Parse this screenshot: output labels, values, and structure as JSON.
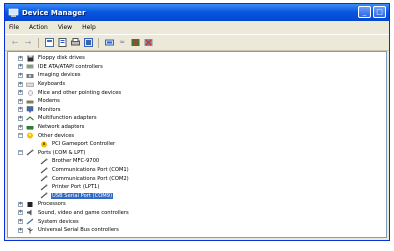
{
  "window": {
    "title": "Device Manager"
  },
  "menu": {
    "file": "File",
    "action": "Action",
    "view": "View",
    "help": "Help"
  },
  "toolbar": {
    "icons": [
      "back-icon",
      "forward-icon",
      "view-icon",
      "properties-icon",
      "print-icon",
      "help-icon",
      "scan-icon",
      "update-driver-icon",
      "disable-icon",
      "uninstall-icon"
    ]
  },
  "tree": {
    "floppy": "Floppy disk drives",
    "ide": "IDE ATA/ATAPI controllers",
    "imaging": "Imaging devices",
    "keyboards": "Keyboards",
    "mice": "Mice and other pointing devices",
    "modems": "Modems",
    "monitors": "Monitors",
    "multifunction": "Multifunction adapters",
    "network": "Network adapters",
    "other": "Other devices",
    "pci": "PCI Gameport Controller",
    "ports": "Ports (COM & LPT)",
    "brother": "Brother MFC-9700",
    "com1": "Communications Port (COM1)",
    "com2": "Communications Port (COM2)",
    "lpt1": "Printer Port (LPT1)",
    "usbserial": "USB Serial Port (COM9)",
    "processors": "Processors",
    "sound": "Sound, video and game controllers",
    "system": "System devices",
    "usb": "Universal Serial Bus controllers"
  },
  "colors": {
    "titlebar": "#0a58e0",
    "selection": "#316ac5",
    "chrome": "#ece9d8"
  }
}
